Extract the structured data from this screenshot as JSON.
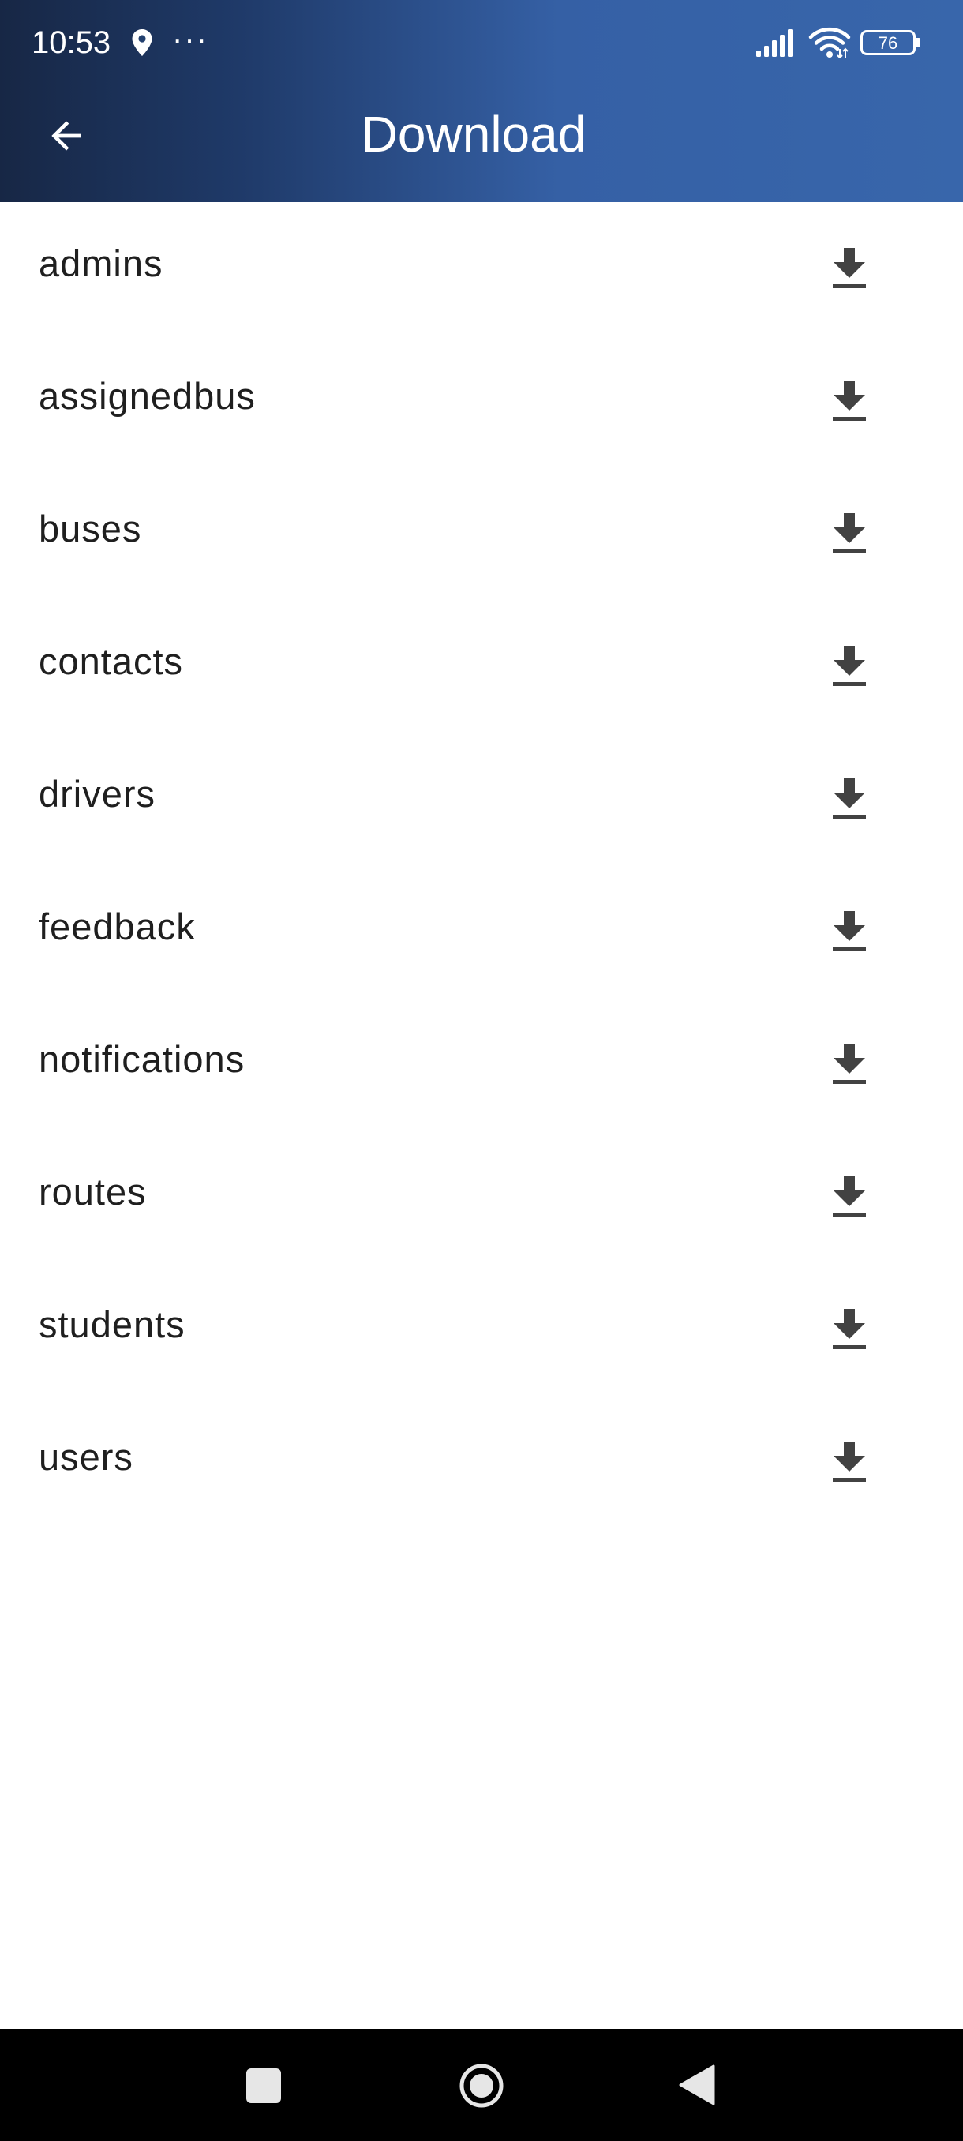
{
  "status_bar": {
    "time": "10:53",
    "dots": "···",
    "battery_level": "76",
    "icons": [
      "location-icon",
      "signal-icon",
      "wifi-icon",
      "battery-icon"
    ]
  },
  "app_bar": {
    "title": "Download",
    "back_icon": "arrow-left-icon",
    "background_gradient": [
      "#172745",
      "#3866ab"
    ]
  },
  "collections": [
    {
      "label": "admins",
      "action_icon": "download-icon"
    },
    {
      "label": "assignedbus",
      "action_icon": "download-icon"
    },
    {
      "label": "buses",
      "action_icon": "download-icon"
    },
    {
      "label": "contacts",
      "action_icon": "download-icon"
    },
    {
      "label": "drivers",
      "action_icon": "download-icon"
    },
    {
      "label": "feedback",
      "action_icon": "download-icon"
    },
    {
      "label": "notifications",
      "action_icon": "download-icon"
    },
    {
      "label": "routes",
      "action_icon": "download-icon"
    },
    {
      "label": "students",
      "action_icon": "download-icon"
    },
    {
      "label": "users",
      "action_icon": "download-icon"
    }
  ],
  "colors": {
    "item_text": "#1f1f1f",
    "icon": "#424242",
    "nav_bar": "#000000"
  },
  "nav_bar": {
    "buttons": [
      "recents-icon",
      "home-icon",
      "back-triangle-icon"
    ]
  }
}
